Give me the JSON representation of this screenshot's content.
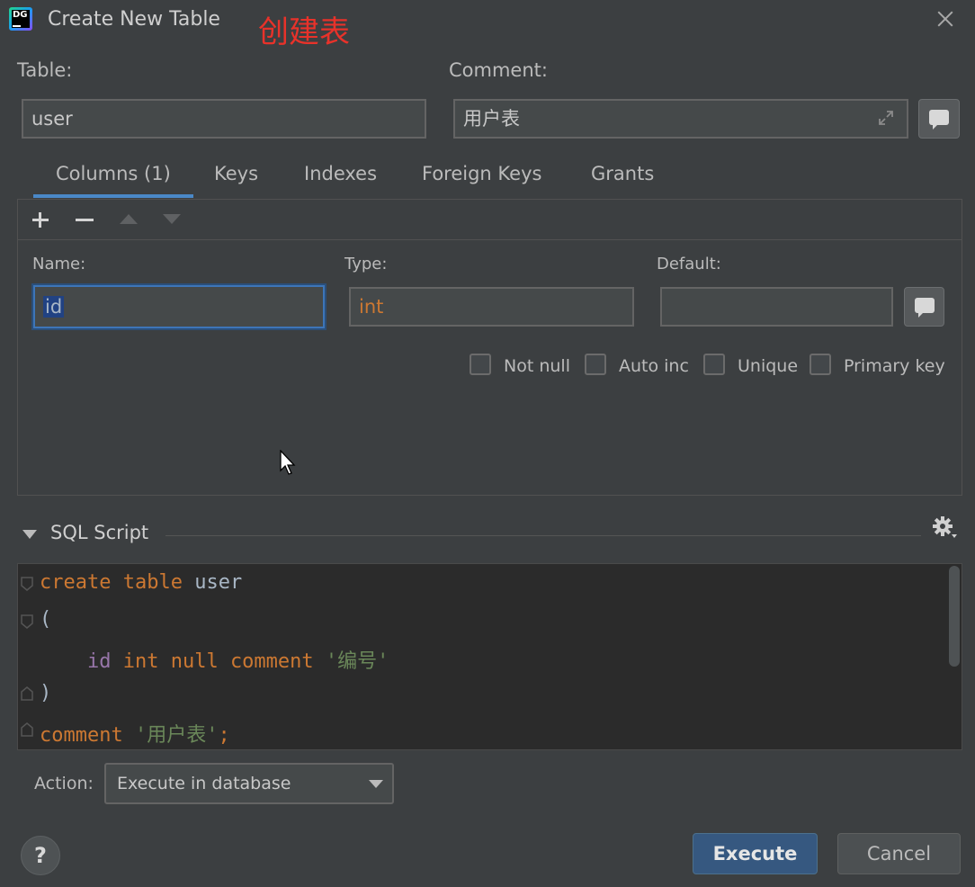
{
  "window": {
    "title": "Create New Table",
    "annotation": "创建表",
    "app_logo_text": "DG"
  },
  "table": {
    "label": "Table:",
    "value": "user"
  },
  "comment": {
    "label": "Comment:",
    "value": "用户表"
  },
  "tabs": [
    {
      "label": "Columns (1)",
      "active": true
    },
    {
      "label": "Keys",
      "active": false
    },
    {
      "label": "Indexes",
      "active": false
    },
    {
      "label": "Foreign Keys",
      "active": false
    },
    {
      "label": "Grants",
      "active": false
    }
  ],
  "column_editor": {
    "name_label": "Name:",
    "name_value": "id",
    "type_label": "Type:",
    "type_value": "int",
    "default_label": "Default:",
    "default_value": "",
    "checkboxes": [
      {
        "label": "Not null",
        "checked": false
      },
      {
        "label": "Auto inc",
        "checked": false
      },
      {
        "label": "Unique",
        "checked": false
      },
      {
        "label": "Primary key",
        "checked": false
      }
    ]
  },
  "sql_script": {
    "title": "SQL Script",
    "lines": {
      "l1_kw1": "create",
      "l1_kw2": "table",
      "l1_id": "user",
      "l2": "(",
      "l3_col": "id",
      "l3_kw": "int null comment",
      "l3_str": "'编号'",
      "l4": ")",
      "l5_kw": "comment",
      "l5_str": "'用户表'",
      "l5_end": ";"
    }
  },
  "action": {
    "label": "Action:",
    "selected": "Execute in database"
  },
  "buttons": {
    "help": "?",
    "execute": "Execute",
    "cancel": "Cancel"
  },
  "colors": {
    "accent": "#365880",
    "annotation": "#e8322a",
    "keyword": "#cc7832",
    "string": "#6a8759",
    "column": "#9876aa"
  }
}
